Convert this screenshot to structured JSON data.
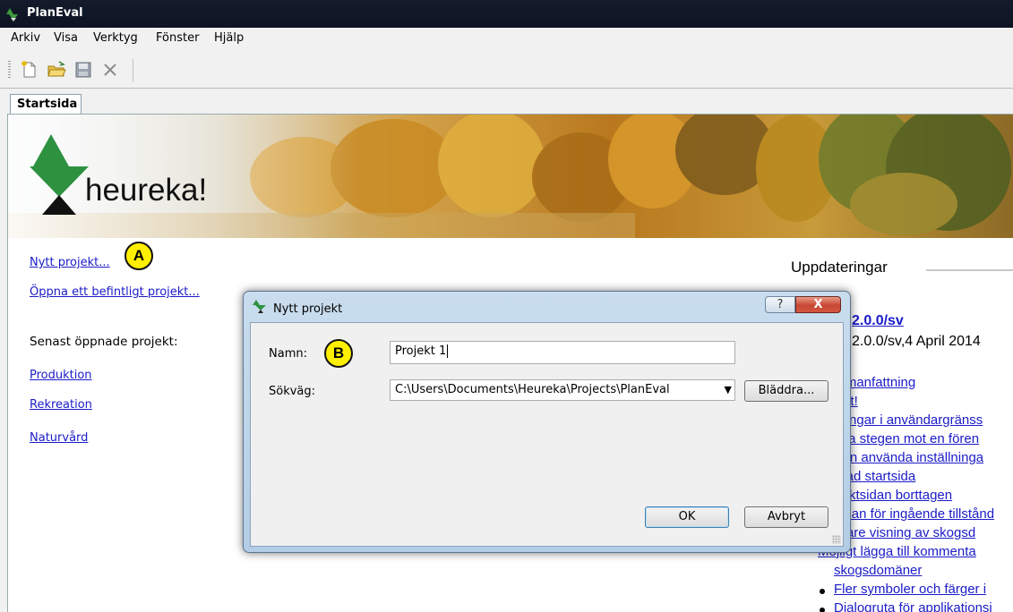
{
  "window": {
    "title": "PlanEval"
  },
  "menu": [
    "Arkiv",
    "Visa",
    "Verktyg",
    "Fönster",
    "Hjälp"
  ],
  "toolbar": {
    "icons": [
      "new-file-icon",
      "open-folder-icon",
      "save-icon",
      "close-icon"
    ]
  },
  "tabs": {
    "active": "Startsida"
  },
  "banner": {
    "logo_text": "heureka!"
  },
  "start": {
    "new_project": "Nytt projekt...",
    "open_project": "Öppna ett befintligt projekt...",
    "recent_heading": "Senast öppnade projekt:",
    "recent": [
      "Produktion",
      "Rekreation",
      "Naturvård"
    ]
  },
  "callouts": {
    "a": "A",
    "b": "B"
  },
  "updates": {
    "heading": "Uppdateringar",
    "version_link": "2.0.0/sv",
    "version_date": "2.0.0/sv,4 April 2014",
    "links": [
      "Sammanfattning",
      "Viktigt!",
      "Ändringar i användargränss",
      "Första stegen mot en fören",
      "Mellan använda inställninga",
      "Ändrad startsida",
      "Projektsidan borttagen",
      "Vyn dan för ingående tillstånd",
      "Tidigare visning av skogsd",
      "Möjligt lägga till kommenta",
      "skogsdomäner"
    ],
    "bullets": [
      "Fler symboler och färger i",
      "Dialogruta för applikationsi"
    ]
  },
  "dialog": {
    "title": "Nytt projekt",
    "help": "?",
    "close": "X",
    "name_label": "Namn:",
    "name_value": "Projekt 1",
    "path_label": "Sökväg:",
    "path_value": "C:\\Users\\Documents\\Heureka\\Projects\\PlanEval",
    "browse": "Bläddra...",
    "ok": "OK",
    "cancel": "Avbryt"
  }
}
